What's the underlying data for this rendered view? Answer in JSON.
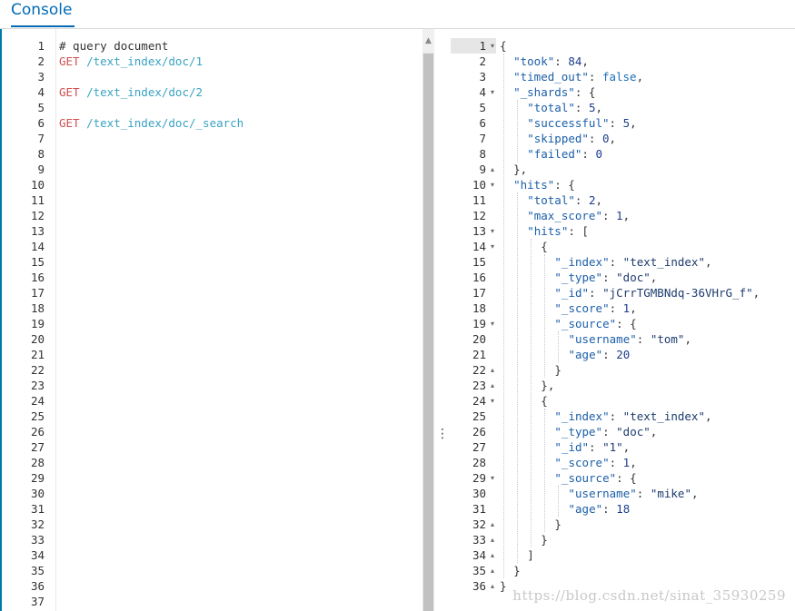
{
  "header": {
    "title": "Console"
  },
  "left_editor": {
    "line_numbers": [
      "1",
      "2",
      "3",
      "4",
      "5",
      "6",
      "7",
      "8",
      "9",
      "10",
      "11",
      "12",
      "13",
      "14",
      "15",
      "16",
      "17",
      "18",
      "19",
      "20",
      "21",
      "22",
      "23",
      "24",
      "25",
      "26",
      "27",
      "28",
      "29",
      "30",
      "31",
      "32",
      "33",
      "34",
      "35",
      "36",
      "37"
    ],
    "lines": [
      {
        "comment": "# query document"
      },
      {
        "method": "GET",
        "path": " /text_index/doc/1"
      },
      {},
      {
        "method": "GET",
        "path": " /text_index/doc/2"
      },
      {},
      {
        "method": "GET",
        "path": " /text_index/doc/_search"
      }
    ]
  },
  "divider": {
    "resize_glyph": "⋮"
  },
  "right_editor": {
    "line_numbers": [
      "1",
      "2",
      "3",
      "4",
      "5",
      "6",
      "7",
      "8",
      "9",
      "10",
      "11",
      "12",
      "13",
      "14",
      "15",
      "16",
      "17",
      "18",
      "19",
      "20",
      "21",
      "22",
      "23",
      "24",
      "25",
      "26",
      "27",
      "28",
      "29",
      "30",
      "31",
      "32",
      "33",
      "34",
      "35",
      "36"
    ],
    "fold_markers": [
      "▾",
      "",
      "",
      "▾",
      "",
      "",
      "",
      "",
      "▴",
      "▾",
      "",
      "",
      "▾",
      "▾",
      "",
      "",
      "",
      "",
      "▾",
      "",
      "",
      "▴",
      "▴",
      "▾",
      "",
      "",
      "",
      "",
      "▾",
      "",
      "",
      "▴",
      "▴",
      "▴",
      "▴",
      "▴"
    ],
    "lines": [
      {
        "indent": 0,
        "parts": [
          [
            "p",
            "{"
          ]
        ]
      },
      {
        "indent": 1,
        "parts": [
          [
            "k",
            "\"took\""
          ],
          [
            "p",
            ": "
          ],
          [
            "n",
            "84"
          ],
          [
            "p",
            ","
          ]
        ]
      },
      {
        "indent": 1,
        "parts": [
          [
            "k",
            "\"timed_out\""
          ],
          [
            "p",
            ": "
          ],
          [
            "b",
            "false"
          ],
          [
            "p",
            ","
          ]
        ]
      },
      {
        "indent": 1,
        "parts": [
          [
            "k",
            "\"_shards\""
          ],
          [
            "p",
            ": {"
          ]
        ]
      },
      {
        "indent": 2,
        "parts": [
          [
            "k",
            "\"total\""
          ],
          [
            "p",
            ": "
          ],
          [
            "n",
            "5"
          ],
          [
            "p",
            ","
          ]
        ]
      },
      {
        "indent": 2,
        "parts": [
          [
            "k",
            "\"successful\""
          ],
          [
            "p",
            ": "
          ],
          [
            "n",
            "5"
          ],
          [
            "p",
            ","
          ]
        ]
      },
      {
        "indent": 2,
        "parts": [
          [
            "k",
            "\"skipped\""
          ],
          [
            "p",
            ": "
          ],
          [
            "n",
            "0"
          ],
          [
            "p",
            ","
          ]
        ]
      },
      {
        "indent": 2,
        "parts": [
          [
            "k",
            "\"failed\""
          ],
          [
            "p",
            ": "
          ],
          [
            "n",
            "0"
          ]
        ]
      },
      {
        "indent": 1,
        "parts": [
          [
            "p",
            "},"
          ]
        ]
      },
      {
        "indent": 1,
        "parts": [
          [
            "k",
            "\"hits\""
          ],
          [
            "p",
            ": {"
          ]
        ]
      },
      {
        "indent": 2,
        "parts": [
          [
            "k",
            "\"total\""
          ],
          [
            "p",
            ": "
          ],
          [
            "n",
            "2"
          ],
          [
            "p",
            ","
          ]
        ]
      },
      {
        "indent": 2,
        "parts": [
          [
            "k",
            "\"max_score\""
          ],
          [
            "p",
            ": "
          ],
          [
            "n",
            "1"
          ],
          [
            "p",
            ","
          ]
        ]
      },
      {
        "indent": 2,
        "parts": [
          [
            "k",
            "\"hits\""
          ],
          [
            "p",
            ": ["
          ]
        ]
      },
      {
        "indent": 3,
        "parts": [
          [
            "p",
            "{"
          ]
        ]
      },
      {
        "indent": 4,
        "parts": [
          [
            "k",
            "\"_index\""
          ],
          [
            "p",
            ": "
          ],
          [
            "s",
            "\"text_index\""
          ],
          [
            "p",
            ","
          ]
        ]
      },
      {
        "indent": 4,
        "parts": [
          [
            "k",
            "\"_type\""
          ],
          [
            "p",
            ": "
          ],
          [
            "s",
            "\"doc\""
          ],
          [
            "p",
            ","
          ]
        ]
      },
      {
        "indent": 4,
        "parts": [
          [
            "k",
            "\"_id\""
          ],
          [
            "p",
            ": "
          ],
          [
            "s",
            "\"jCrrTGMBNdq-36VHrG_f\""
          ],
          [
            "p",
            ","
          ]
        ]
      },
      {
        "indent": 4,
        "parts": [
          [
            "k",
            "\"_score\""
          ],
          [
            "p",
            ": "
          ],
          [
            "n",
            "1"
          ],
          [
            "p",
            ","
          ]
        ]
      },
      {
        "indent": 4,
        "parts": [
          [
            "k",
            "\"_source\""
          ],
          [
            "p",
            ": {"
          ]
        ]
      },
      {
        "indent": 5,
        "parts": [
          [
            "k",
            "\"username\""
          ],
          [
            "p",
            ": "
          ],
          [
            "s",
            "\"tom\""
          ],
          [
            "p",
            ","
          ]
        ]
      },
      {
        "indent": 5,
        "parts": [
          [
            "k",
            "\"age\""
          ],
          [
            "p",
            ": "
          ],
          [
            "n",
            "20"
          ]
        ]
      },
      {
        "indent": 4,
        "parts": [
          [
            "p",
            "}"
          ]
        ]
      },
      {
        "indent": 3,
        "parts": [
          [
            "p",
            "},"
          ]
        ]
      },
      {
        "indent": 3,
        "parts": [
          [
            "p",
            "{"
          ]
        ]
      },
      {
        "indent": 4,
        "parts": [
          [
            "k",
            "\"_index\""
          ],
          [
            "p",
            ": "
          ],
          [
            "s",
            "\"text_index\""
          ],
          [
            "p",
            ","
          ]
        ]
      },
      {
        "indent": 4,
        "parts": [
          [
            "k",
            "\"_type\""
          ],
          [
            "p",
            ": "
          ],
          [
            "s",
            "\"doc\""
          ],
          [
            "p",
            ","
          ]
        ]
      },
      {
        "indent": 4,
        "parts": [
          [
            "k",
            "\"_id\""
          ],
          [
            "p",
            ": "
          ],
          [
            "s",
            "\"1\""
          ],
          [
            "p",
            ","
          ]
        ]
      },
      {
        "indent": 4,
        "parts": [
          [
            "k",
            "\"_score\""
          ],
          [
            "p",
            ": "
          ],
          [
            "n",
            "1"
          ],
          [
            "p",
            ","
          ]
        ]
      },
      {
        "indent": 4,
        "parts": [
          [
            "k",
            "\"_source\""
          ],
          [
            "p",
            ": {"
          ]
        ]
      },
      {
        "indent": 5,
        "parts": [
          [
            "k",
            "\"username\""
          ],
          [
            "p",
            ": "
          ],
          [
            "s",
            "\"mike\""
          ],
          [
            "p",
            ","
          ]
        ]
      },
      {
        "indent": 5,
        "parts": [
          [
            "k",
            "\"age\""
          ],
          [
            "p",
            ": "
          ],
          [
            "n",
            "18"
          ]
        ]
      },
      {
        "indent": 4,
        "parts": [
          [
            "p",
            "}"
          ]
        ]
      },
      {
        "indent": 3,
        "parts": [
          [
            "p",
            "}"
          ]
        ]
      },
      {
        "indent": 2,
        "parts": [
          [
            "p",
            "]"
          ]
        ]
      },
      {
        "indent": 1,
        "parts": [
          [
            "p",
            "}"
          ]
        ]
      },
      {
        "indent": 0,
        "parts": [
          [
            "p",
            "}"
          ]
        ]
      }
    ]
  },
  "watermark": "https://blog.csdn.net/sinat_35930259"
}
